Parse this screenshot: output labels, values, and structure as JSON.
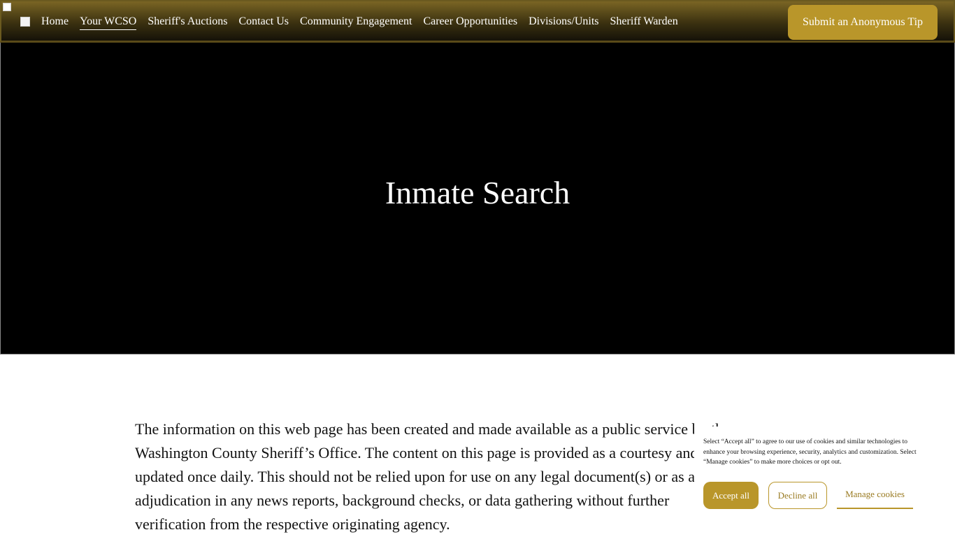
{
  "nav": {
    "items": [
      {
        "label": "Home",
        "active": false
      },
      {
        "label": "Your WCSO",
        "active": true
      },
      {
        "label": "Sheriff's Auctions",
        "active": false
      },
      {
        "label": "Contact Us",
        "active": false
      },
      {
        "label": "Community Engagement",
        "active": false
      },
      {
        "label": "Career Opportunities",
        "active": false
      },
      {
        "label": "Divisions/Units",
        "active": false
      },
      {
        "label": "Sheriff Warden",
        "active": false
      }
    ],
    "tip_button": "Submit an Anonymous Tip"
  },
  "hero": {
    "title": "Inmate Search"
  },
  "content": {
    "paragraph": "The information on this web page has been created and made available as a public service by the Washington County Sheriff’s Office. The content on this page is provided as a courtesy and is updated once daily.   This should not be relied upon for use on any legal document(s) or as an adjudication in any news reports, background checks, or data gathering without further verification from the respective originating agency."
  },
  "cookie": {
    "text": "Select “Accept all” to agree to our use of cookies and similar technologies to enhance your browsing experience, security, analytics and customization. Select “Manage cookies” to make more choices or opt out.",
    "accept_label": "Accept all",
    "decline_label": "Decline all",
    "manage_label": "Manage cookies"
  },
  "colors": {
    "accent": "#b9962a",
    "hero_bg": "#000000"
  }
}
